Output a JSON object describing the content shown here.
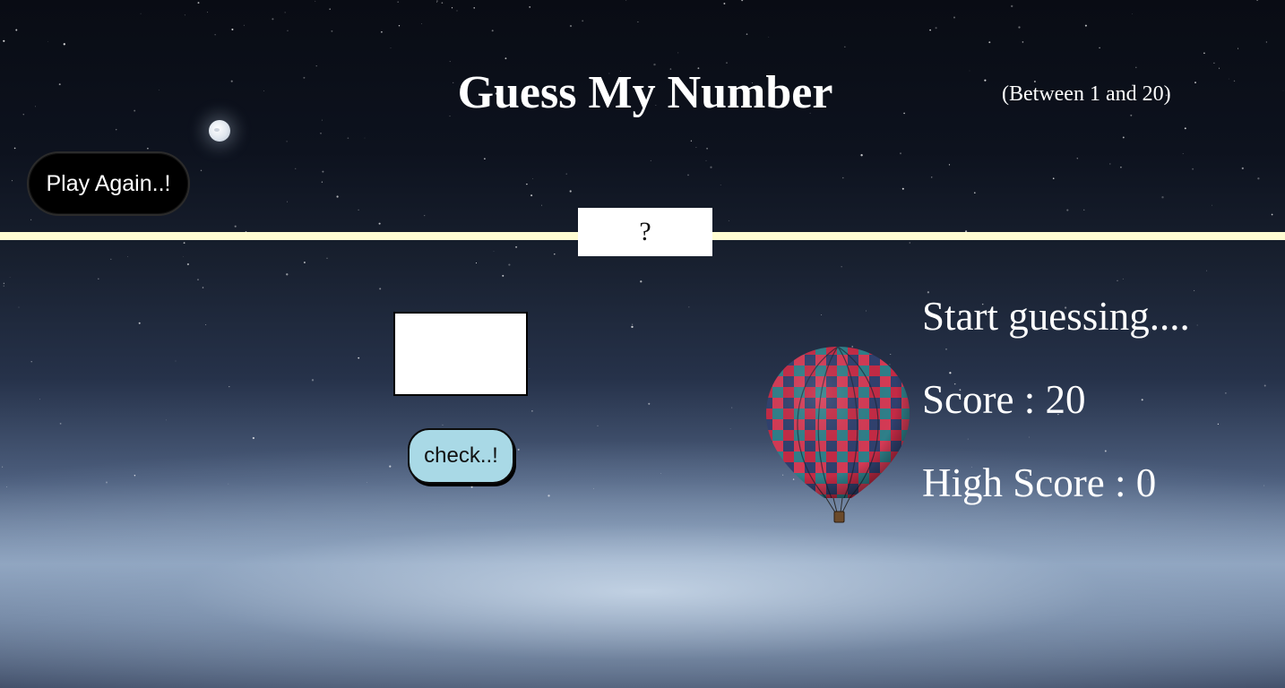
{
  "game": {
    "title": "Guess My Number",
    "range_hint": "(Between 1 and 20)",
    "secret_display": "?",
    "guess_value": "",
    "buttons": {
      "play_again": "Play Again..!",
      "check": "check..!"
    },
    "message": "Start guessing....",
    "score_text": "Score : 20",
    "highscore_text": "High Score : 0"
  },
  "colors": {
    "divider": "#fffcd2",
    "check_button": "#a9d9e6",
    "play_again_button": "#000000",
    "text": "#ffffff"
  },
  "icons": {
    "moon": "moon-icon",
    "balloon": "hot-air-balloon-icon"
  }
}
